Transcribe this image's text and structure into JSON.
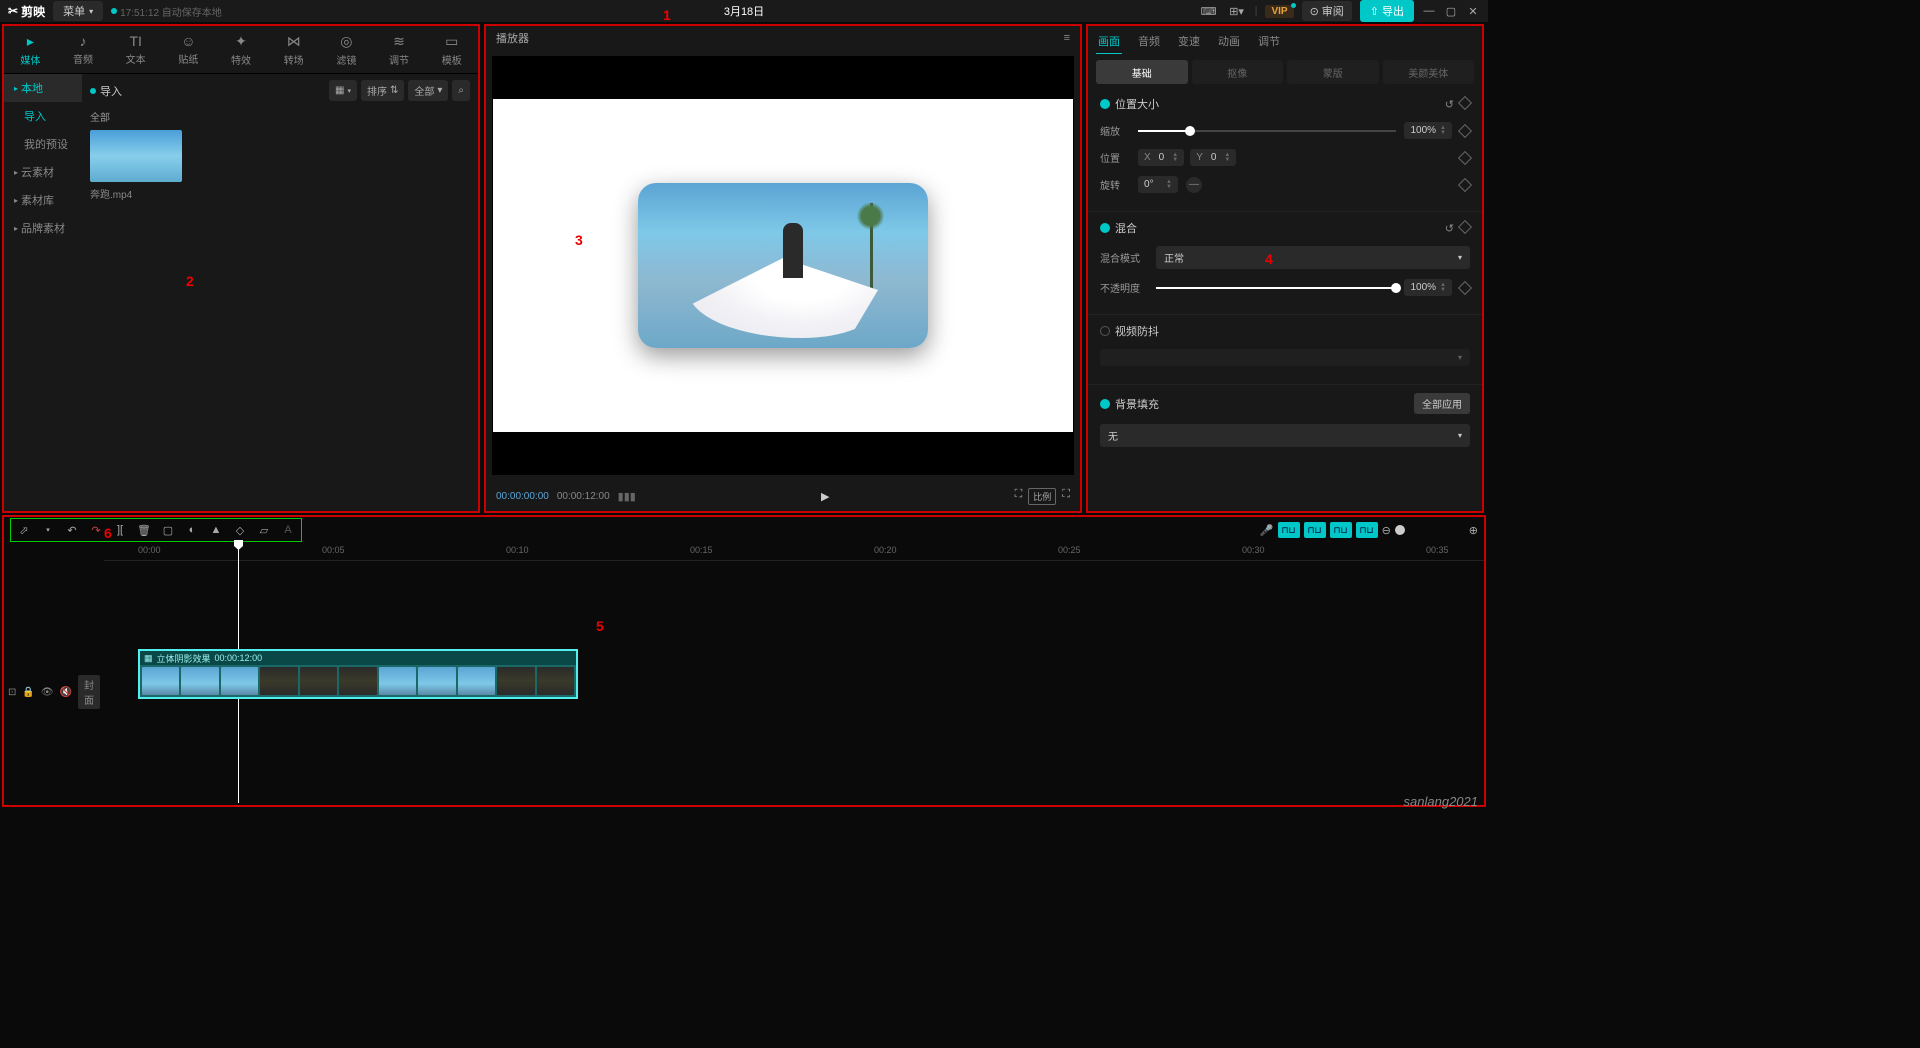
{
  "topbar": {
    "app_name": "剪映",
    "menu": "菜单",
    "autosave": "17:51:12 自动保存本地",
    "title": "3月18日",
    "vip": "VIP",
    "review": "审阅",
    "export": "导出"
  },
  "tool_tabs": [
    {
      "icon": "▸",
      "label": "媒体"
    },
    {
      "icon": "♪",
      "label": "音频"
    },
    {
      "icon": "TI",
      "label": "文本"
    },
    {
      "icon": "☺",
      "label": "贴纸"
    },
    {
      "icon": "✦",
      "label": "特效"
    },
    {
      "icon": "⋈",
      "label": "转场"
    },
    {
      "icon": "◎",
      "label": "滤镜"
    },
    {
      "icon": "≋",
      "label": "调节"
    },
    {
      "icon": "▭",
      "label": "模板"
    }
  ],
  "sidebar": {
    "items": [
      "本地",
      "导入",
      "我的预设",
      "云素材",
      "素材库",
      "品牌素材"
    ]
  },
  "media": {
    "import": "导入",
    "sort": "排序",
    "all_filter": "全部",
    "all_label": "全部",
    "thumb_name": "奔跑.mp4"
  },
  "player": {
    "title": "播放器",
    "current_time": "00:00:00:00",
    "duration": "00:00:12:00",
    "ratio": "比例"
  },
  "prop_tabs": [
    "画面",
    "音频",
    "变速",
    "动画",
    "调节"
  ],
  "sub_tabs": [
    "基础",
    "抠像",
    "蒙版",
    "美颜美体"
  ],
  "props": {
    "position_size": "位置大小",
    "scale": "缩放",
    "scale_val": "100%",
    "position": "位置",
    "pos_x": "0",
    "pos_y": "0",
    "rotation": "旋转",
    "rotation_val": "0°",
    "blend": "混合",
    "blend_mode": "混合模式",
    "blend_normal": "正常",
    "opacity": "不透明度",
    "opacity_val": "100%",
    "stabilize": "视频防抖",
    "bg_fill": "背景填充",
    "apply_all": "全部应用",
    "none": "无"
  },
  "timeline": {
    "cover": "封面",
    "ticks": [
      "00:00",
      "00:05",
      "00:10",
      "00:15",
      "00:20",
      "00:25",
      "00:30",
      "00:35"
    ],
    "clip_name": "立体阴影效果",
    "clip_dur": "00:00:12:00"
  },
  "annotations": {
    "a1": "1",
    "a2": "2",
    "a3": "3",
    "a4": "4",
    "a5": "5",
    "a6": "6"
  },
  "watermark": "sanlang2021"
}
